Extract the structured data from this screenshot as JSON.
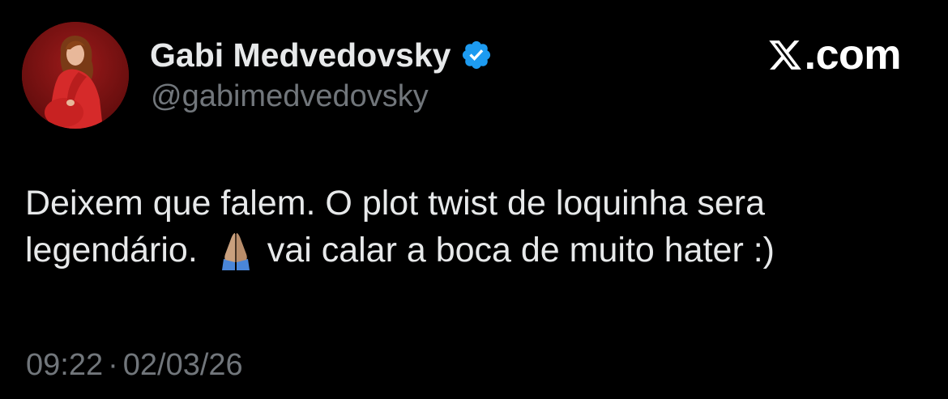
{
  "tweet": {
    "author": {
      "display_name": "Gabi Medvedovsky",
      "handle": "@gabimedvedovsky",
      "verified": true,
      "verified_icon": "verified-badge-icon",
      "avatar": "profile-photo"
    },
    "brand": {
      "icon": "x-logo-icon",
      "text": ".com"
    },
    "body": {
      "line1": "Deixem que falem. O plot twist de loquinha sera",
      "line2_before_emoji": "legendário.",
      "emoji": "praying-hands-icon",
      "line2_after_emoji": "vai calar a boca de muito hater :)"
    },
    "meta": {
      "time": "09:22",
      "separator": "·",
      "date": "02/03/26"
    }
  },
  "colors": {
    "background": "#000000",
    "primary_text": "#e7e9ea",
    "secondary_text": "#71767b",
    "verified_blue": "#1d9bf0"
  }
}
